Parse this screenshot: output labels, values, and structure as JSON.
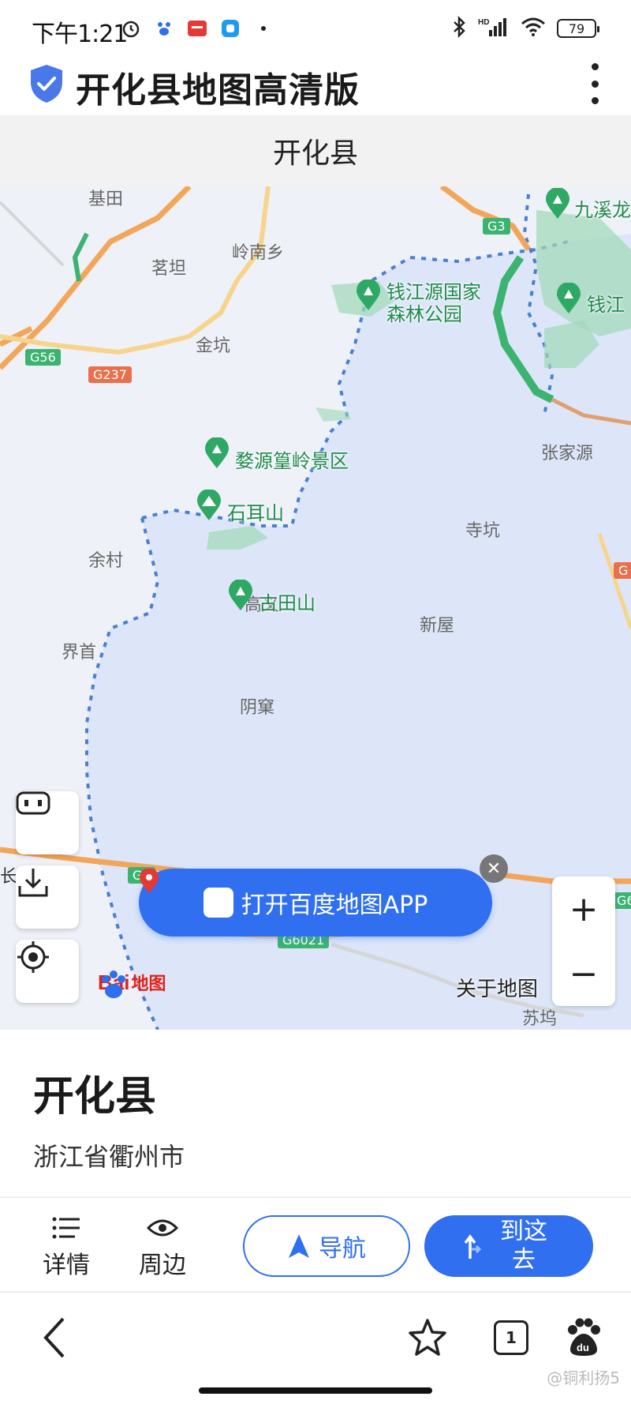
{
  "status_bar": {
    "time": "下午1:21",
    "battery": "79",
    "network": "HD"
  },
  "header": {
    "title": "开化县地图高清版"
  },
  "page": {
    "subtitle": "开化县"
  },
  "map": {
    "place_labels": [
      {
        "name": "基田"
      },
      {
        "name": "茗坦"
      },
      {
        "name": "岭南乡"
      },
      {
        "name": "金坑"
      },
      {
        "name": "张家源"
      },
      {
        "name": "寺坑"
      },
      {
        "name": "余村"
      },
      {
        "name": "高义"
      },
      {
        "name": "新屋"
      },
      {
        "name": "界首"
      },
      {
        "name": "阴窠"
      },
      {
        "name": "苏坞"
      }
    ],
    "poi_labels": [
      {
        "name": "九溪龙"
      },
      {
        "name": "钱江源国家"
      },
      {
        "name": "森林公园"
      },
      {
        "name": "钱江"
      },
      {
        "name": "婺源篁岭景区"
      },
      {
        "name": "石耳山"
      },
      {
        "name": "古田山"
      }
    ],
    "road_shields": [
      {
        "code": "G3"
      },
      {
        "code": "G56"
      },
      {
        "code": "G237"
      },
      {
        "code": "G6"
      },
      {
        "code": "G6021"
      },
      {
        "code": "G6"
      },
      {
        "code": "G"
      }
    ],
    "open_app_label": "打开百度地图APP",
    "zoom_in": "+",
    "zoom_out": "−",
    "about_label": "关于地图",
    "logo_text": "Bai",
    "logo_suffix": "地图",
    "edge_text": "长"
  },
  "place": {
    "name": "开化县",
    "region": "浙江省衢州市"
  },
  "actions": {
    "details_label": "详情",
    "nearby_label": "周边",
    "navigate_label": "导航",
    "go_line1": "到这",
    "go_line2": "去"
  },
  "browser_bar": {
    "tab_count": "1",
    "watermark": "@铜利扬5"
  },
  "colors": {
    "accent": "#2f6ff0",
    "poi_green": "#1f8a4c",
    "boundary_blue": "#4a7fd0",
    "road_orange": "#f3a65a",
    "baidu_red": "#e2231a"
  }
}
